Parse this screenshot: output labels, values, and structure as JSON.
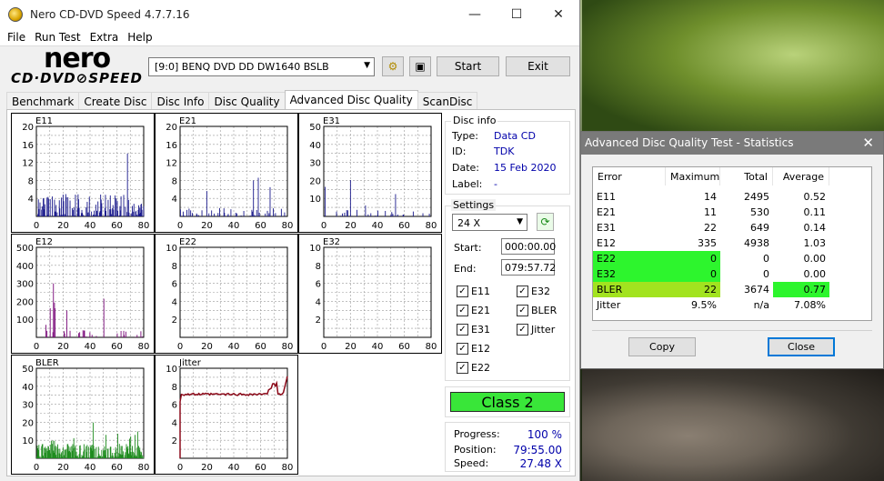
{
  "window": {
    "title": "Nero CD-DVD Speed 4.7.7.16",
    "minimize": "—",
    "maximize": "☐",
    "close": "✕"
  },
  "menu": [
    "File",
    "Run Test",
    "Extra",
    "Help"
  ],
  "logo": {
    "top": "nero",
    "bottom": "CD·DVD⊘SPEED"
  },
  "toolbar": {
    "drive": "[9:0]   BENQ DVD DD DW1640 BSLB",
    "start_label": "Start",
    "exit_label": "Exit"
  },
  "tabs": [
    "Benchmark",
    "Create Disc",
    "Disc Info",
    "Disc Quality",
    "Advanced Disc Quality",
    "ScanDisc"
  ],
  "active_tab": "Advanced Disc Quality",
  "disc_info": {
    "title": "Disc info",
    "type_key": "Type:",
    "type_val": "Data CD",
    "id_key": "ID:",
    "id_val": "TDK",
    "date_key": "Date:",
    "date_val": "15 Feb 2020",
    "label_key": "Label:",
    "label_val": "-"
  },
  "settings": {
    "title": "Settings",
    "speed": "24 X",
    "start_label": "Start:",
    "start_val": "000:00.00",
    "end_label": "End:",
    "end_val": "079:57.72",
    "checks": [
      {
        "label": "E11",
        "checked": true
      },
      {
        "label": "E32",
        "checked": true
      },
      {
        "label": "E21",
        "checked": true
      },
      {
        "label": "BLER",
        "checked": true
      },
      {
        "label": "E31",
        "checked": true
      },
      {
        "label": "Jitter",
        "checked": true
      },
      {
        "label": "E12",
        "checked": true
      },
      {
        "label": "E22",
        "checked": true
      }
    ]
  },
  "class_label": "Class 2",
  "progress": {
    "progress_key": "Progress:",
    "progress_val": "100 %",
    "position_key": "Position:",
    "position_val": "79:55.00",
    "speed_key": "Speed:",
    "speed_val": "27.48 X"
  },
  "chart_data": [
    {
      "type": "bar",
      "title": "E11",
      "color": "#1a1a8c",
      "x_ticks": [
        "0",
        "20",
        "40",
        "60",
        "80"
      ],
      "y_ticks": [
        "4",
        "8",
        "12",
        "16",
        "20"
      ],
      "ylim": [
        0,
        20
      ]
    },
    {
      "type": "bar",
      "title": "E21",
      "color": "#1a1a8c",
      "x_ticks": [
        "0",
        "20",
        "40",
        "60",
        "80"
      ],
      "y_ticks": [
        "4",
        "8",
        "12",
        "16",
        "20"
      ],
      "ylim": [
        0,
        20
      ]
    },
    {
      "type": "bar",
      "title": "E31",
      "color": "#1a1a8c",
      "x_ticks": [
        "0",
        "20",
        "40",
        "60",
        "80"
      ],
      "y_ticks": [
        "10",
        "20",
        "30",
        "40",
        "50"
      ],
      "ylim": [
        0,
        50
      ]
    },
    {
      "type": "bar",
      "title": "E12",
      "color": "#7a0a7a",
      "x_ticks": [
        "0",
        "20",
        "40",
        "60",
        "80"
      ],
      "y_ticks": [
        "100",
        "200",
        "300",
        "400",
        "500"
      ],
      "ylim": [
        0,
        500
      ]
    },
    {
      "type": "bar",
      "title": "E22",
      "color": "#1a1a8c",
      "x_ticks": [
        "0",
        "20",
        "40",
        "60",
        "80"
      ],
      "y_ticks": [
        "2",
        "4",
        "6",
        "8",
        "10"
      ],
      "ylim": [
        0,
        10
      ]
    },
    {
      "type": "bar",
      "title": "E32",
      "color": "#1a1a8c",
      "x_ticks": [
        "0",
        "20",
        "40",
        "60",
        "80"
      ],
      "y_ticks": [
        "2",
        "4",
        "6",
        "8",
        "10"
      ],
      "ylim": [
        0,
        10
      ]
    },
    {
      "type": "bar",
      "title": "BLER",
      "color": "#1f8c1f",
      "x_ticks": [
        "0",
        "20",
        "40",
        "60",
        "80"
      ],
      "y_ticks": [
        "10",
        "20",
        "30",
        "40",
        "50"
      ],
      "ylim": [
        0,
        50
      ]
    },
    {
      "type": "line",
      "title": "Jitter",
      "color": "#8c0a1a",
      "x_ticks": [
        "0",
        "20",
        "40",
        "60",
        "80"
      ],
      "y_ticks": [
        "2",
        "4",
        "6",
        "8",
        "10"
      ],
      "ylim": [
        0,
        10
      ]
    }
  ],
  "stats_dialog": {
    "title": "Advanced Disc Quality Test - Statistics",
    "close": "✕",
    "headers": [
      "Error",
      "Maximum",
      "Total",
      "Average"
    ],
    "rows": [
      {
        "name": "E11",
        "max": "14",
        "total": "2495",
        "avg": "0.52",
        "hl": ""
      },
      {
        "name": "E21",
        "max": "11",
        "total": "530",
        "avg": "0.11",
        "hl": ""
      },
      {
        "name": "E31",
        "max": "22",
        "total": "649",
        "avg": "0.14",
        "hl": ""
      },
      {
        "name": "E12",
        "max": "335",
        "total": "4938",
        "avg": "1.03",
        "hl": ""
      },
      {
        "name": "E22",
        "max": "0",
        "total": "0",
        "avg": "0.00",
        "hl": "green"
      },
      {
        "name": "E32",
        "max": "0",
        "total": "0",
        "avg": "0.00",
        "hl": "green"
      },
      {
        "name": "BLER",
        "max": "22",
        "total": "3674",
        "avg": "0.77",
        "hl": "lime"
      },
      {
        "name": "Jitter",
        "max": "9.5%",
        "total": "n/a",
        "avg": "7.08%",
        "hl": ""
      }
    ],
    "copy_label": "Copy",
    "close_label": "Close"
  }
}
